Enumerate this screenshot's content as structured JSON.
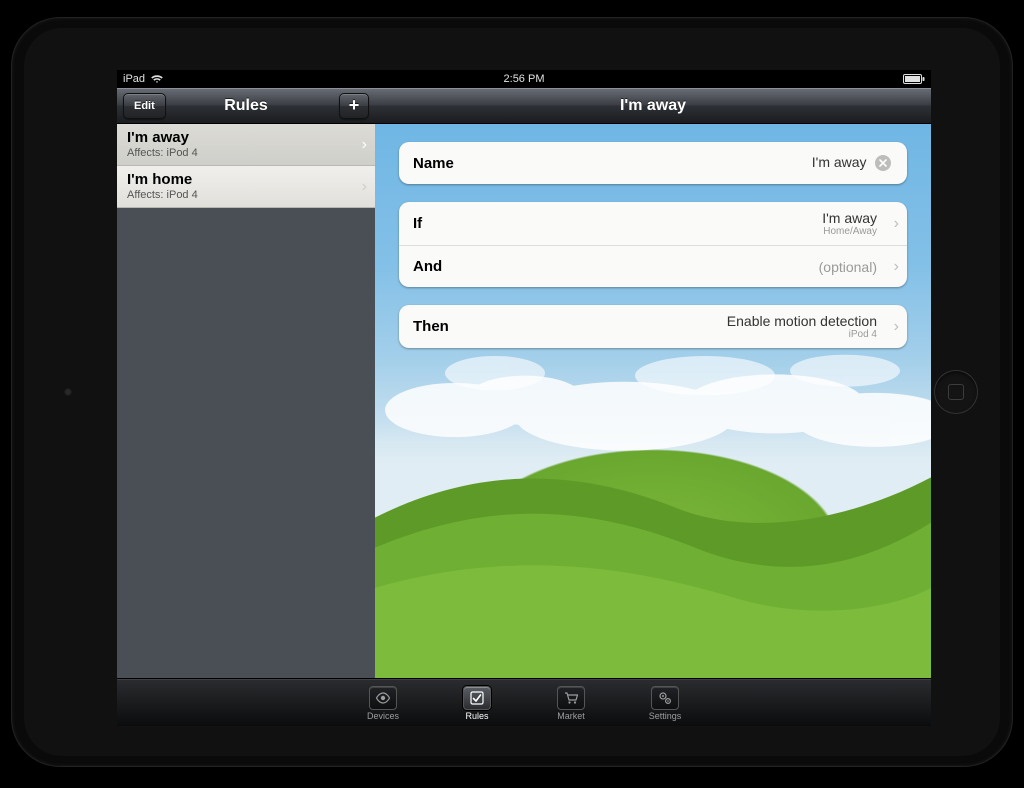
{
  "statusbar": {
    "carrier": "iPad",
    "time": "2:56 PM"
  },
  "sidebar": {
    "title": "Rules",
    "edit_label": "Edit",
    "add_label": "+",
    "items": [
      {
        "name": "I'm away",
        "affects": "Affects: iPod 4",
        "selected": true
      },
      {
        "name": "I'm home",
        "affects": "Affects: iPod 4",
        "selected": false
      }
    ]
  },
  "detail": {
    "title": "I'm away",
    "rows": {
      "name": {
        "label": "Name",
        "value": "I'm away"
      },
      "if": {
        "label": "If",
        "value": "I'm away",
        "sub": "Home/Away"
      },
      "and": {
        "label": "And",
        "value": "(optional)"
      },
      "then": {
        "label": "Then",
        "value": "Enable motion detection",
        "sub": "iPod 4"
      }
    }
  },
  "tabs": [
    {
      "id": "devices",
      "label": "Devices",
      "icon": "eye-icon"
    },
    {
      "id": "rules",
      "label": "Rules",
      "icon": "check-icon",
      "active": true
    },
    {
      "id": "market",
      "label": "Market",
      "icon": "cart-icon"
    },
    {
      "id": "settings",
      "label": "Settings",
      "icon": "gears-icon"
    }
  ]
}
